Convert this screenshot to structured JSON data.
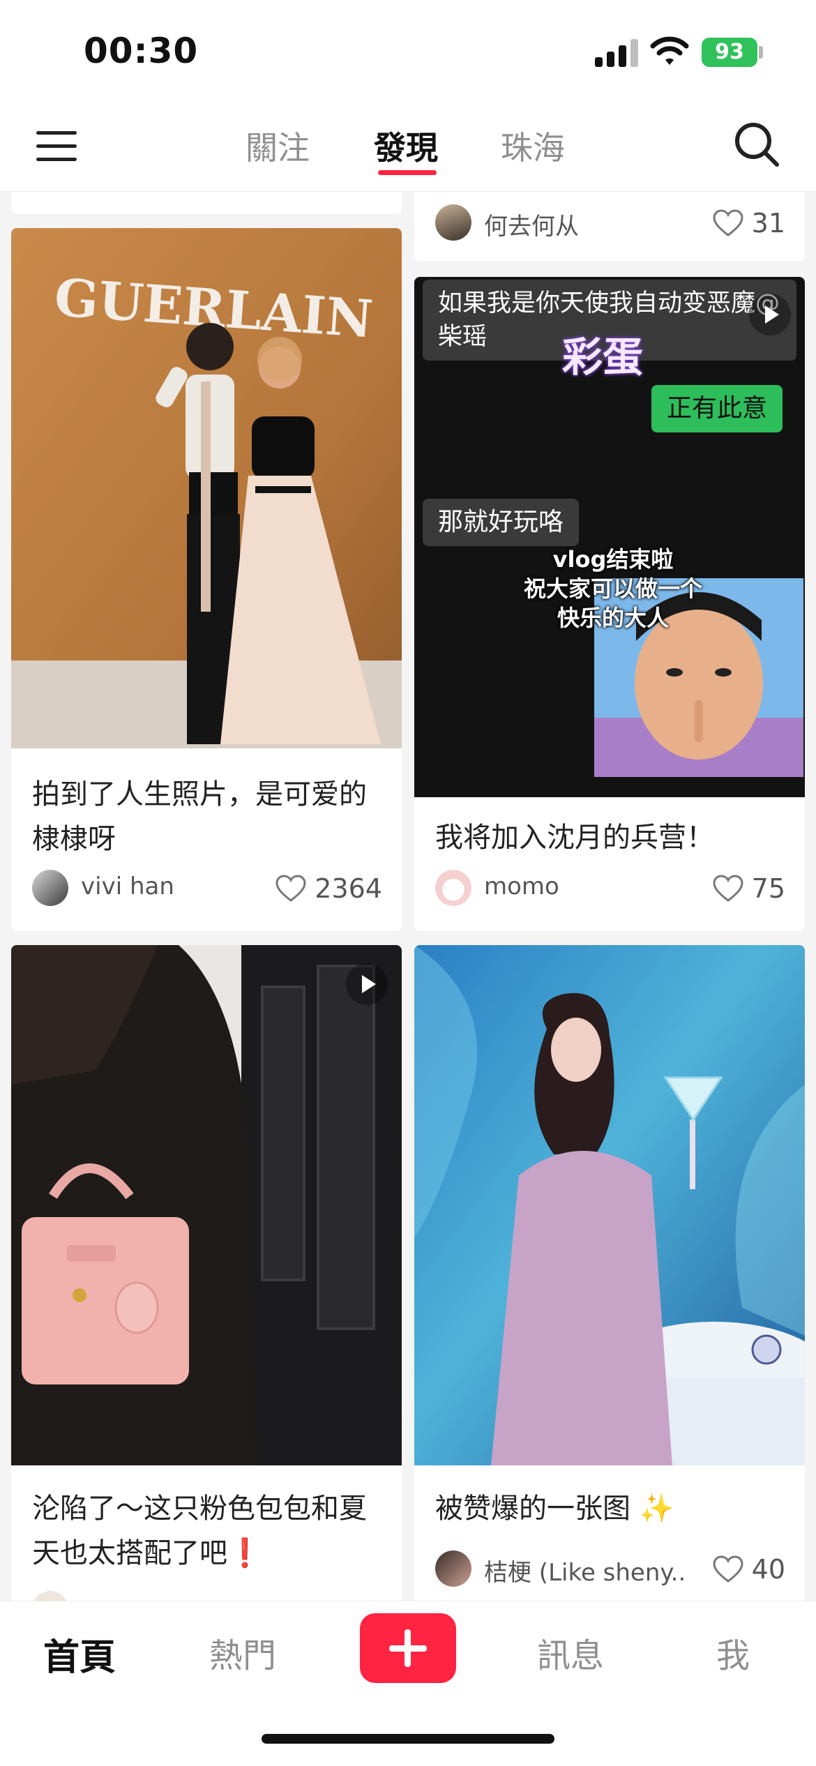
{
  "status_bar": {
    "time": "00:30",
    "battery": "93"
  },
  "header": {
    "tabs": [
      {
        "label": "關注",
        "active": false
      },
      {
        "label": "發現",
        "active": true
      },
      {
        "label": "珠海",
        "active": false
      }
    ]
  },
  "feed": {
    "cards": [
      {
        "author": "",
        "likes": ""
      },
      {
        "author": "何去何从",
        "likes": "31"
      },
      {
        "title": "拍到了人生照片，是可爱的棣棣呀",
        "author": "vivi han",
        "likes": "2364",
        "image_text": "GUERLAIN"
      },
      {
        "title": "我将加入沈月的兵营！",
        "author": "momo",
        "likes": "75",
        "video_overlay": {
          "bubble_top": "如果我是你天使我自动变恶魔@柴瑶",
          "sticker": "彩蛋",
          "bubble_green": "正有此意",
          "bubble_mid": "那就好玩咯",
          "caption": "vlog结束啦\n祝大家可以做一个\n快乐的大人"
        }
      },
      {
        "title": "沦陷了～这只粉色包包和夏天也太搭配了吧❗️"
      },
      {
        "title": "被赞爆的一张图 ✨",
        "author": "桔梗 (Like sheny...",
        "likes": "40"
      }
    ]
  },
  "bottom_nav": {
    "items": [
      {
        "label": "首頁",
        "active": true
      },
      {
        "label": "熱門",
        "active": false
      },
      {
        "label": "訊息",
        "active": false
      },
      {
        "label": "我",
        "active": false
      }
    ]
  },
  "colors": {
    "accent": "#ff2442",
    "chat_green": "#2ebd5b",
    "battery_green": "#2fc25b"
  }
}
